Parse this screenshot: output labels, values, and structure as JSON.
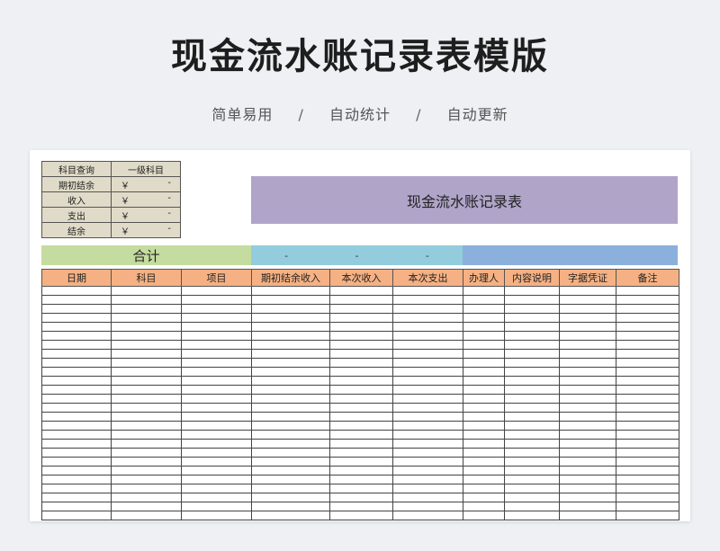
{
  "title": "现金流水账记录表模版",
  "subtitle": {
    "items": [
      "简单易用",
      "自动统计",
      "自动更新"
    ],
    "separator": "/"
  },
  "summary": {
    "header": [
      "科目查询",
      "一级科目"
    ],
    "rows": [
      {
        "label": "期初结余",
        "currency": "￥",
        "value": "-"
      },
      {
        "label": "收入",
        "currency": "￥",
        "value": "-"
      },
      {
        "label": "支出",
        "currency": "￥",
        "value": "-"
      },
      {
        "label": "结余",
        "currency": "￥",
        "value": "-"
      }
    ]
  },
  "banner": "现金流水账记录表",
  "totals": {
    "label": "合计",
    "values": [
      "-",
      "-",
      "-"
    ]
  },
  "table": {
    "columns": [
      "日期",
      "科目",
      "项目",
      "期初结余收入",
      "本次收入",
      "本次支出",
      "办理人",
      "内容说明",
      "字据凭证",
      "备注"
    ],
    "row_count": 26
  },
  "colors": {
    "summary_bg": "#e0dbc8",
    "banner_bg": "#b1a4c9",
    "total_label_bg": "#c4dc9f",
    "total_values_bg": "#93ccdc",
    "total_right_bg": "#8cb0dc",
    "header_bg": "#f5b183"
  }
}
